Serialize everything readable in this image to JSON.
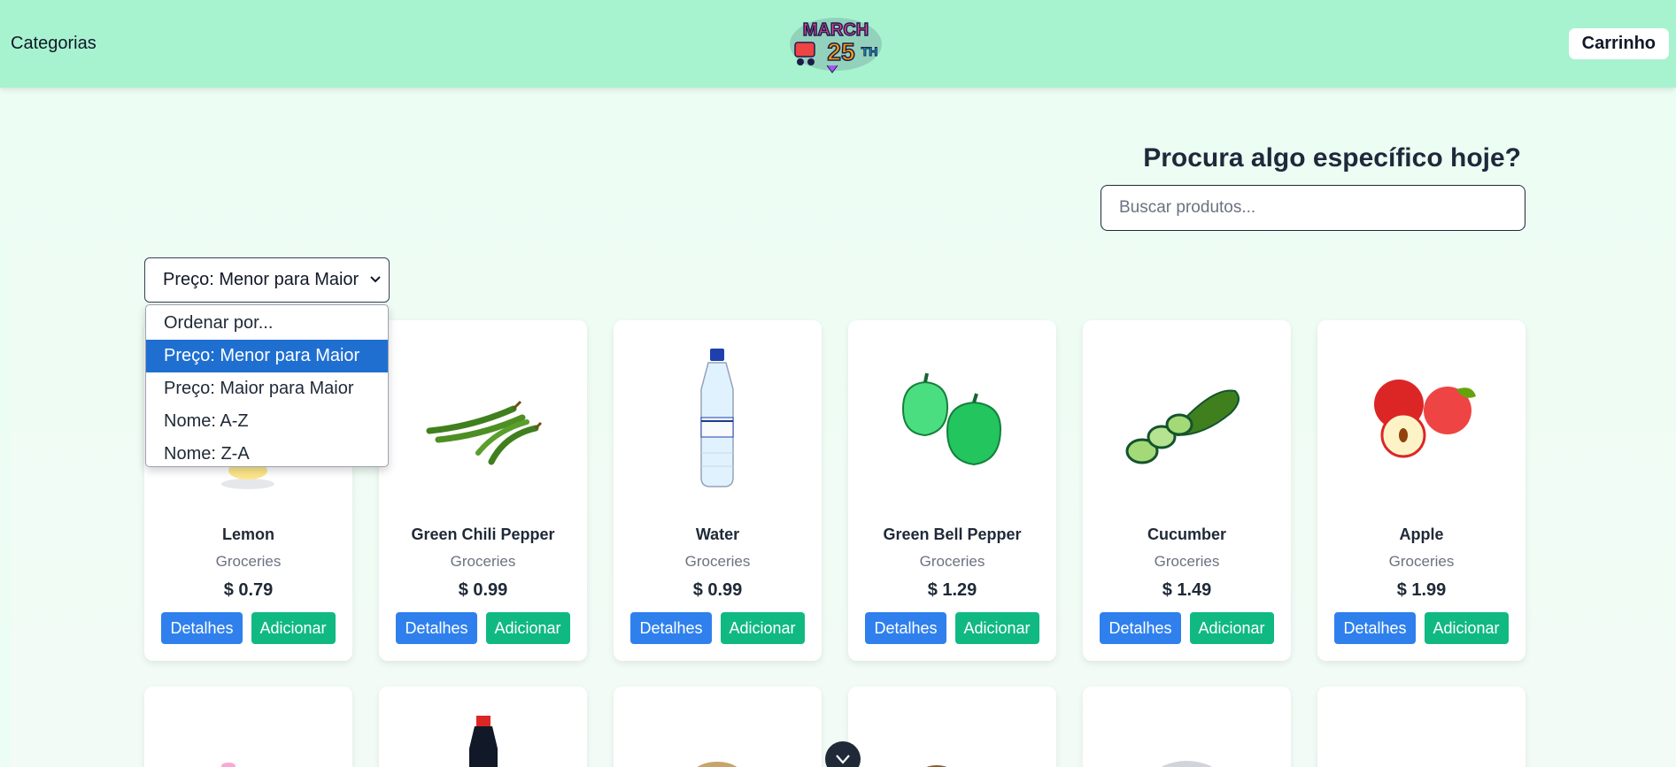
{
  "header": {
    "categories_label": "Categorias",
    "logo_text": "MARCH 25TH",
    "cart_label": "Carrinho"
  },
  "search": {
    "title": "Procura algo específico hoje?",
    "placeholder": "Buscar produtos..."
  },
  "sort": {
    "selected": "Preço: Menor para Maior",
    "options": [
      "Ordenar por...",
      "Preço: Menor para Maior",
      "Preço: Maior para Maior",
      "Nome: A-Z",
      "Nome: Z-A"
    ]
  },
  "products": [
    {
      "name": "Lemon",
      "category": "Groceries",
      "price": "$ 0.79",
      "details_label": "Detalhes",
      "add_label": "Adicionar",
      "icon": "lemon-image"
    },
    {
      "name": "Green Chili Pepper",
      "category": "Groceries",
      "price": "$ 0.99",
      "details_label": "Detalhes",
      "add_label": "Adicionar",
      "icon": "chili-pepper-image"
    },
    {
      "name": "Water",
      "category": "Groceries",
      "price": "$ 0.99",
      "details_label": "Detalhes",
      "add_label": "Adicionar",
      "icon": "water-bottle-image"
    },
    {
      "name": "Green Bell Pepper",
      "category": "Groceries",
      "price": "$ 1.29",
      "details_label": "Detalhes",
      "add_label": "Adicionar",
      "icon": "bell-pepper-image"
    },
    {
      "name": "Cucumber",
      "category": "Groceries",
      "price": "$ 1.49",
      "details_label": "Detalhes",
      "add_label": "Adicionar",
      "icon": "cucumber-image"
    },
    {
      "name": "Apple",
      "category": "Groceries",
      "price": "$ 1.99",
      "details_label": "Detalhes",
      "add_label": "Adicionar",
      "icon": "apple-image"
    }
  ],
  "colors": {
    "header_bg": "#a7f3d0",
    "page_bg": "#ecfdf3",
    "details_button": "#2f80ed",
    "add_button": "#10b981",
    "selected_option": "#1f6fd1"
  }
}
